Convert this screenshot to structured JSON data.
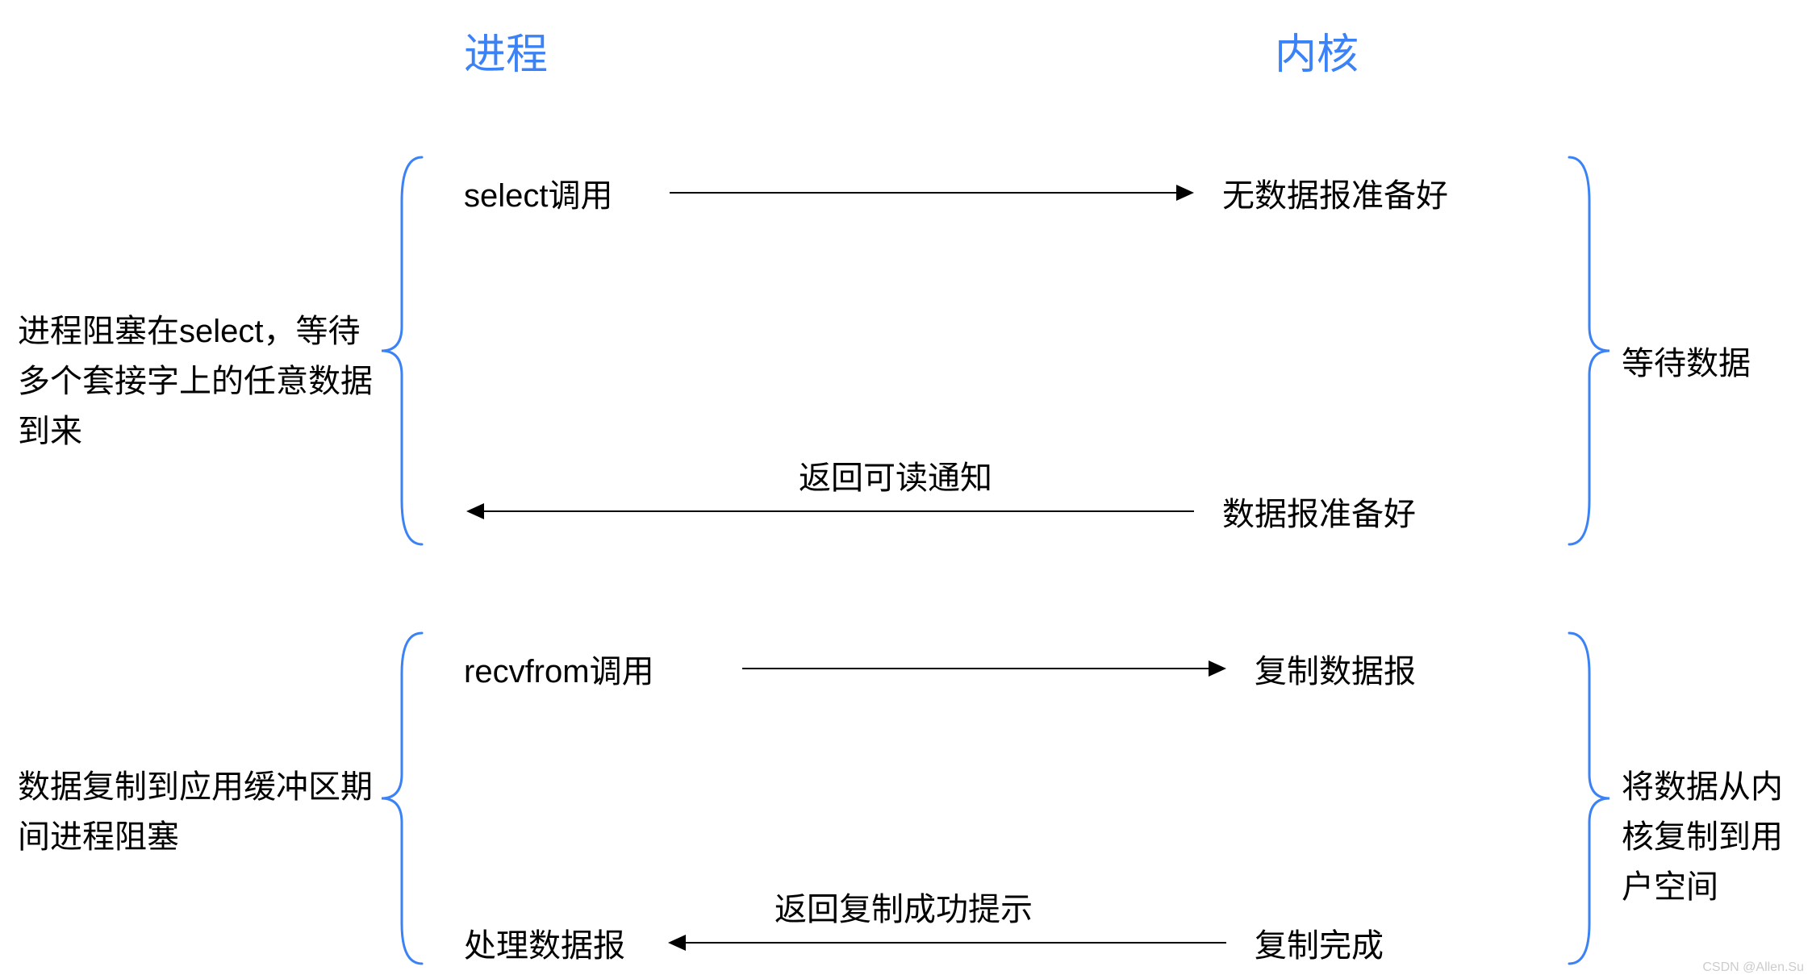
{
  "headers": {
    "process": "进程",
    "kernel": "内核"
  },
  "phase1": {
    "left_desc": "进程阻塞在select，等待多个套接字上的任意数据到来",
    "right_desc": "等待数据",
    "top_left": "select调用",
    "top_right": "无数据报准备好",
    "bottom_right": "数据报准备好",
    "return_label": "返回可读通知"
  },
  "phase2": {
    "left_desc": "数据复制到应用缓冲区期间进程阻塞",
    "right_desc": "将数据从内核复制到用户空间",
    "top_left": "recvfrom调用",
    "top_right": "复制数据报",
    "bottom_left": "处理数据报",
    "bottom_right": "复制完成",
    "return_label": "返回复制成功提示"
  },
  "watermark": "CSDN @Allen.Su"
}
